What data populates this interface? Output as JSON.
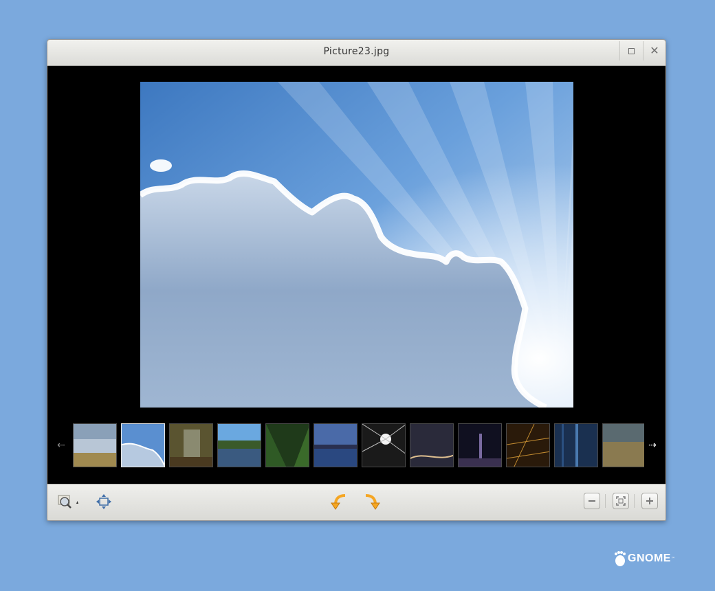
{
  "window": {
    "title": "Picture23.jpg"
  },
  "thumbnails": [
    {
      "name": "grass-field-thumbnail",
      "selected": false
    },
    {
      "name": "sky-clouds-thumbnail",
      "selected": true
    },
    {
      "name": "misty-forest-thumbnail",
      "selected": false
    },
    {
      "name": "lake-island-thumbnail",
      "selected": false
    },
    {
      "name": "green-valley-thumbnail",
      "selected": false
    },
    {
      "name": "city-lake-dusk-thumbnail",
      "selected": false
    },
    {
      "name": "light-burst-thumbnail",
      "selected": false
    },
    {
      "name": "night-highway-thumbnail",
      "selected": false
    },
    {
      "name": "city-skyline-night-thumbnail",
      "selected": false
    },
    {
      "name": "city-lights-aerial-thumbnail",
      "selected": false
    },
    {
      "name": "blue-forest-thumbnail",
      "selected": false
    },
    {
      "name": "dry-grassland-thumbnail",
      "selected": false
    }
  ],
  "toolbar": {
    "icons": [
      "zoom-menu-icon",
      "fit-icon",
      "rotate-left-icon",
      "rotate-right-icon",
      "zoom-out-icon",
      "best-fit-icon",
      "zoom-in-icon"
    ]
  },
  "branding": {
    "logo_text": "GNOME",
    "tm": "™"
  },
  "colors": {
    "desktop": "#7ba9dd",
    "viewer_bg": "#000000",
    "rotate_arrow": "#f5a623"
  }
}
